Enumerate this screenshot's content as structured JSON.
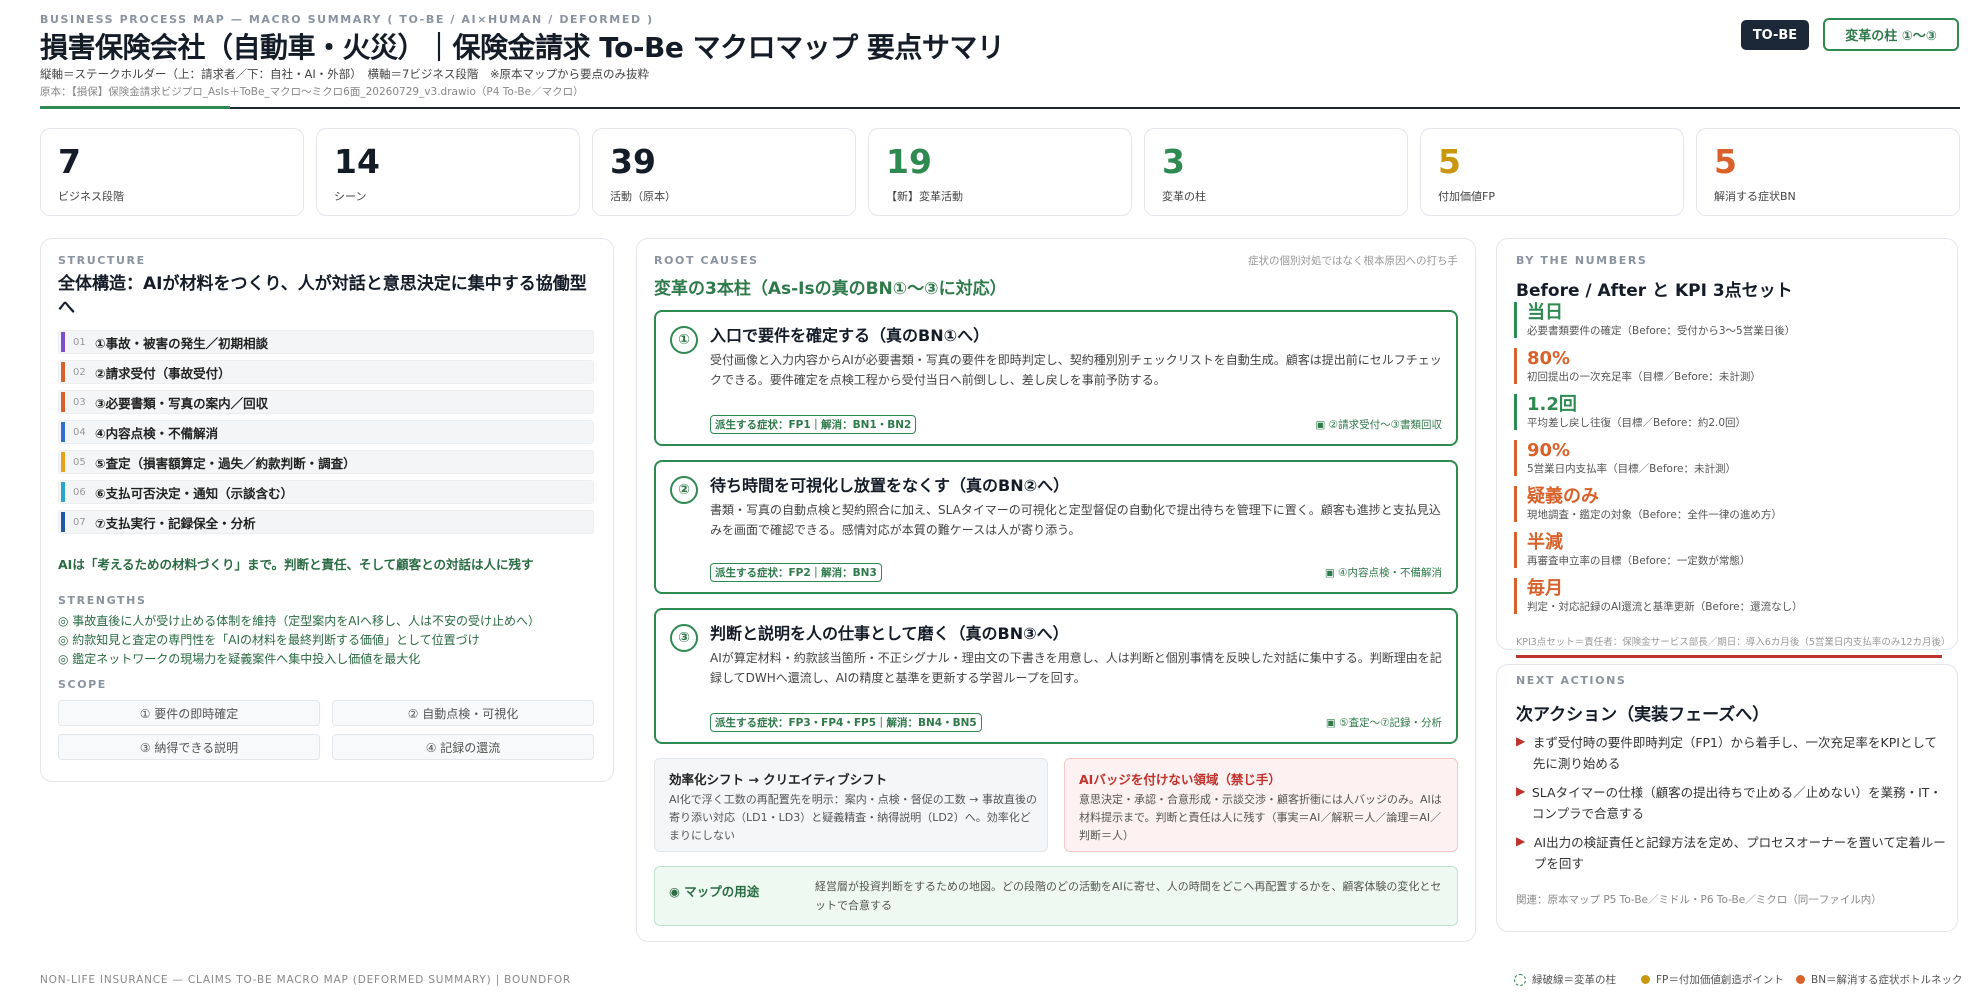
{
  "header": {
    "eyebrow": "BUSINESS PROCESS MAP — MACRO SUMMARY ( TO-BE / AI×HUMAN / DEFORMED )",
    "title": "損害保険会社（自動車・火災）｜保険金請求 To-Be マクロマップ 要点サマリ",
    "subtitle": "縦軸＝ステークホルダー（上：請求者／下：自社・AI・外部）　横軸＝7ビジネス段階　※原本マップから要点のみ抜粋",
    "source": "原本：【損保】保険金請求ビジプロ_AsIs＋ToBe_マクロ〜ミクロ6面_20260729_v3.drawio（P4 To-Be／マクロ）",
    "badge_tobe": "TO-BE",
    "badge_pillars": "変革の柱 ①〜③"
  },
  "colors": {
    "green": "#2f8a52",
    "dark": "#141c28",
    "gold": "#c9970f",
    "orange": "#d9622b",
    "red": "#c0322c"
  },
  "stats": [
    {
      "value": "7",
      "label": "ビジネス段階",
      "color": "#141c28"
    },
    {
      "value": "14",
      "label": "シーン",
      "color": "#141c28"
    },
    {
      "value": "39",
      "label": "活動（原本）",
      "color": "#141c28"
    },
    {
      "value": "19",
      "label": "【新】変革活動",
      "color": "#2f8a52"
    },
    {
      "value": "3",
      "label": "変革の柱",
      "color": "#2f8a52"
    },
    {
      "value": "5",
      "label": "付加価値FP",
      "color": "#c9970f"
    },
    {
      "value": "5",
      "label": "解消する症状BN",
      "color": "#d9622b"
    }
  ],
  "structure": {
    "eyebrow": "STRUCTURE",
    "title": "全体構造：AIが材料をつくり、人が対話と意思決定に集中する協働型へ",
    "steps": [
      {
        "no": "01",
        "label": "①事故・被害の発生／初期相談",
        "color": "#7b4fd0"
      },
      {
        "no": "02",
        "label": "②請求受付（事故受付）",
        "color": "#d9622b"
      },
      {
        "no": "03",
        "label": "③必要書類・写真の案内／回収",
        "color": "#d9622b"
      },
      {
        "no": "04",
        "label": "④内容点検・不備解消",
        "color": "#2f6fd0"
      },
      {
        "no": "05",
        "label": "⑤査定（損害額算定・過失／約款判断・調査）",
        "color": "#e7a21b"
      },
      {
        "no": "06",
        "label": "⑥支払可否決定・通知（示談含む）",
        "color": "#2aa6c9"
      },
      {
        "no": "07",
        "label": "⑦支払実行・記録保全・分析",
        "color": "#2456a8"
      }
    ],
    "statement": "AIは「考えるための材料づくり」まで。判断と責任、そして顧客との対話は人に残す",
    "strengths_eyebrow": "STRENGTHS",
    "strengths": [
      "◎ 事故直後に人が受け止める体制を維持（定型案内をAIへ移し、人は不安の受け止めへ）",
      "◎ 約款知見と査定の専門性を「AIの材料を最終判断する価値」として位置づけ",
      "◎ 鑑定ネットワークの現場力を疑義案件へ集中投入し価値を最大化"
    ],
    "scope_eyebrow": "SCOPE",
    "scope": [
      "① 要件の即時確定",
      "② 自動点検・可視化",
      "③ 納得できる説明",
      "④ 記録の還流"
    ]
  },
  "root": {
    "eyebrow": "ROOT CAUSES",
    "note": "症状の個別対処ではなく根本原因への打ち手",
    "title": "変革の3本柱（As-Isの真のBN①〜③に対応）",
    "pillars": [
      {
        "num": "①",
        "title": "入口で要件を確定する（真のBN①へ）",
        "desc": "受付画像と入力内容からAIが必要書類・写真の要件を即時判定し、契約種別別チェックリストを自動生成。顧客は提出前にセルフチェックできる。要件確定を点検工程から受付当日へ前倒しし、差し戻しを事前予防する。",
        "tag": "派生する症状：FP1｜解消：BN1・BN2",
        "rel": "▣ ②請求受付〜③書類回収"
      },
      {
        "num": "②",
        "title": "待ち時間を可視化し放置をなくす（真のBN②へ）",
        "desc": "書類・写真の自動点検と契約照合に加え、SLAタイマーの可視化と定型督促の自動化で提出待ちを管理下に置く。顧客も進捗と支払見込みを画面で確認できる。感情対応が本質の難ケースは人が寄り添う。",
        "tag": "派生する症状：FP2｜解消：BN3",
        "rel": "▣ ④内容点検・不備解消"
      },
      {
        "num": "③",
        "title": "判断と説明を人の仕事として磨く（真のBN③へ）",
        "desc": "AIが算定材料・約款該当箇所・不正シグナル・理由文の下書きを用意し、人は判断と個別事情を反映した対話に集中する。判断理由を記録してDWHへ還流し、AIの精度と基準を更新する学習ループを回す。",
        "tag": "派生する症状：FP3・FP4・FP5｜解消：BN4・BN5",
        "rel": "▣ ⑤査定〜⑦記録・分析"
      }
    ],
    "shift_title": "効率化シフト → クリエイティブシフト",
    "shift_desc": "AI化で浮く工数の再配置先を明示：案内・点検・督促の工数 → 事故直後の寄り添い対応（LD1・LD3）と疑義精査・納得説明（LD2）へ。効率化どまりにしない",
    "noai_title": "AIバッジを付けない領域（禁じ手）",
    "noai_desc": "意思決定・承認・合意形成・示談交渉・顧客折衝には人バッジのみ。AIは材料提示まで。判断と責任は人に残す（事実＝AI／解釈＝人／論理＝AI／判断＝人）",
    "usage_title": "◉ マップの用途",
    "usage_desc": "経営層が投資判断をするための地図。どの段階のどの活動をAIに寄せ、人の時間をどこへ再配置するかを、顧客体験の変化とセットで合意する"
  },
  "numbers": {
    "eyebrow": "BY THE NUMBERS",
    "title": "Before / After と KPI 3点セット",
    "kpis": [
      {
        "value": "当日",
        "label": "必要書類要件の確定（Before：受付から3〜5営業日後）",
        "color": "#2f8a52"
      },
      {
        "value": "80%",
        "label": "初回提出の一次充足率（目標／Before：未計測）",
        "color": "#d9622b"
      },
      {
        "value": "1.2回",
        "label": "平均差し戻し往復（目標／Before：約2.0回）",
        "color": "#2f8a52"
      },
      {
        "value": "90%",
        "label": "5営業日内支払率（目標／Before：未計測）",
        "color": "#d9622b"
      },
      {
        "value": "疑義のみ",
        "label": "現地調査・鑑定の対象（Before：全件一律の進め方）",
        "color": "#d9622b"
      },
      {
        "value": "半減",
        "label": "再審査申立率の目標（Before：一定数が常態）",
        "color": "#d9622b"
      },
      {
        "value": "毎月",
        "label": "判定・対応記録のAI還流と基準更新（Before：還流なし）",
        "color": "#d9622b"
      }
    ],
    "foot": "KPI3点セット＝責任者：保険金サービス部長／期日：導入6カ月後（5営業日内支払率のみ12カ月後）"
  },
  "next": {
    "eyebrow": "NEXT ACTIONS",
    "title": "次アクション（実装フェーズへ）",
    "items": [
      "まず受付時の要件即時判定（FP1）から着手し、一次充足率をKPIとして先に測り始める",
      "SLAタイマーの仕様（顧客の提出待ちで止める／止めない）を業務・IT・コンプラで合意する",
      "AI出力の検証責任と記録方法を定め、プロセスオーナーを置いて定着ループを回す"
    ],
    "related": "関連：原本マップ P5 To-Be／ミドル・P6 To-Be／ミクロ（同一ファイル内）"
  },
  "footer": {
    "left": "NON-LIFE INSURANCE — CLAIMS TO-BE MACRO MAP (DEFORMED SUMMARY) | BOUNDFOR",
    "legend": [
      "緑破線＝変革の柱",
      "FP＝付加価値創造ポイント",
      "BN＝解消する症状ボトルネック"
    ]
  }
}
